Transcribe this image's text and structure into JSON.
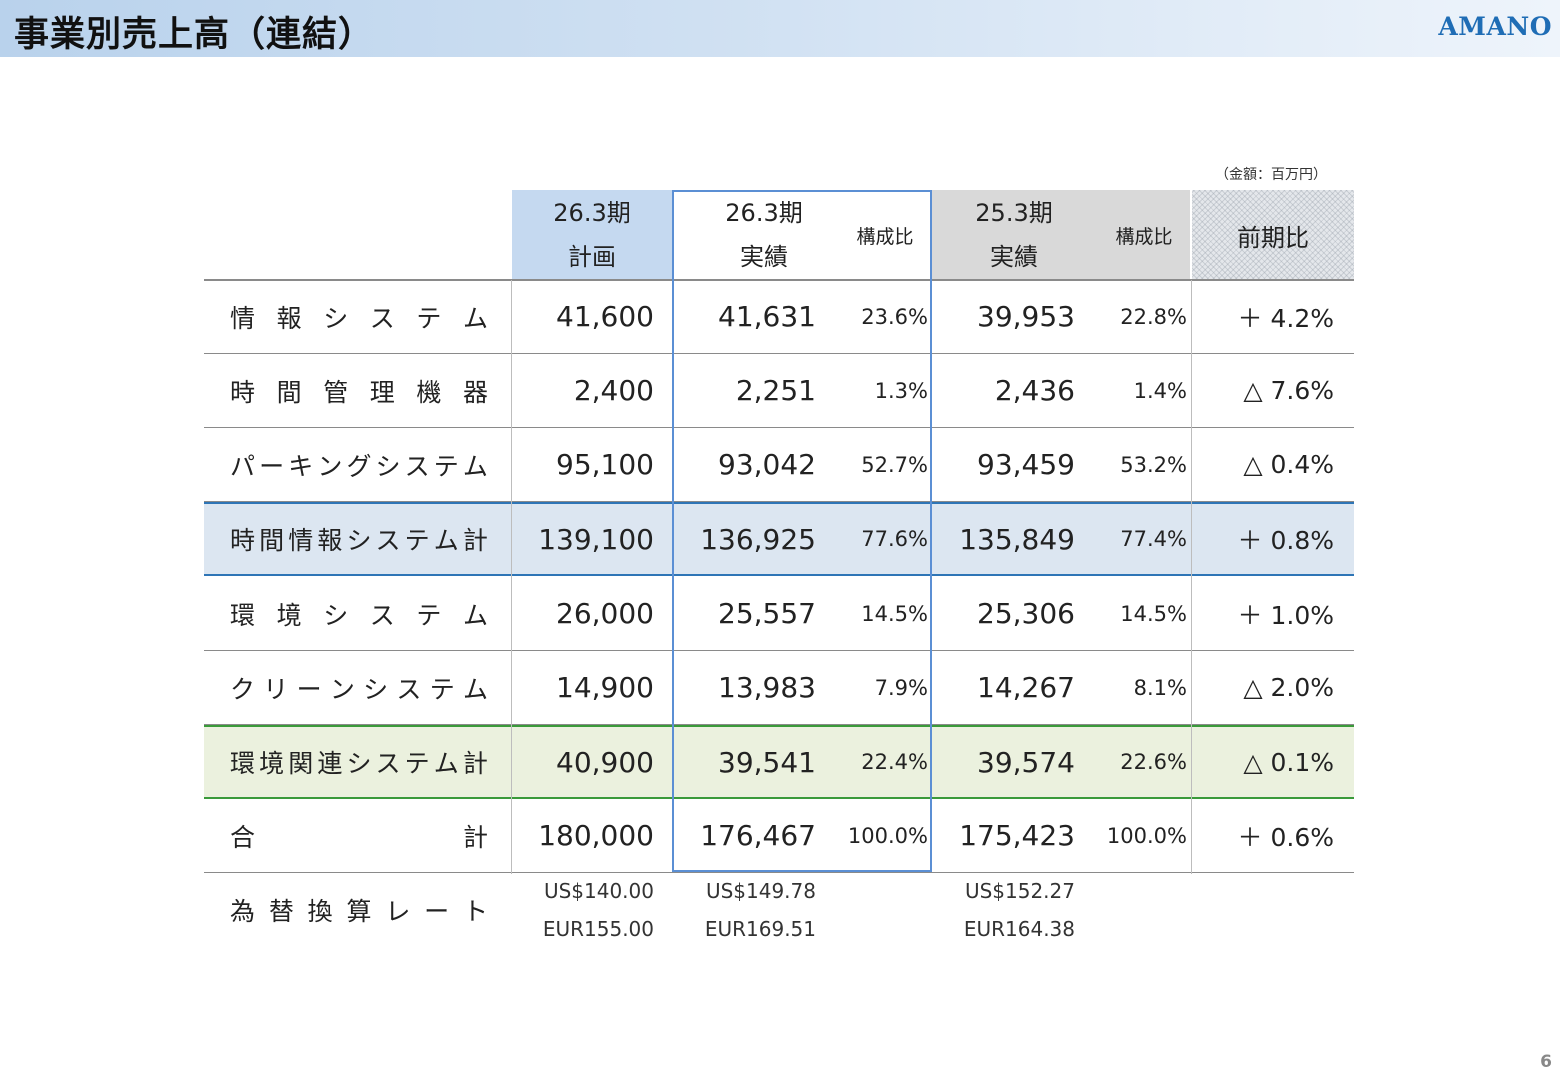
{
  "header": {
    "title": "事業別売上高（連結）",
    "logo": "AMANO"
  },
  "unit_note": "（金額：百万円）",
  "page_number": "6",
  "columns": {
    "plan": {
      "line1": "26.3期",
      "line2": "計画"
    },
    "actual": {
      "line1": "26.3期",
      "line2": "実績",
      "ratio": "構成比"
    },
    "prev": {
      "line1": "25.3期",
      "line2": "実績",
      "ratio": "構成比"
    },
    "yoy": "前期比"
  },
  "rows": [
    {
      "label_chars": [
        "情",
        "報",
        "シ",
        "ス",
        "テ",
        "ム"
      ],
      "plan": "41,600",
      "actual": "41,631",
      "actual_ratio": "23.6%",
      "prev": "39,953",
      "prev_ratio": "22.8%",
      "yoy": "＋ 4.2%"
    },
    {
      "label_chars": [
        "時",
        "間",
        "管",
        "理",
        "機",
        "器"
      ],
      "plan": "2,400",
      "actual": "2,251",
      "actual_ratio": "1.3%",
      "prev": "2,436",
      "prev_ratio": "1.4%",
      "yoy": "△ 7.6%"
    },
    {
      "label_chars": [
        "パ",
        "ー",
        "キ",
        "ン",
        "グ",
        "シ",
        "ス",
        "テ",
        "ム"
      ],
      "plan": "95,100",
      "actual": "93,042",
      "actual_ratio": "52.7%",
      "prev": "93,459",
      "prev_ratio": "53.2%",
      "yoy": "△ 0.4%"
    },
    {
      "label_chars": [
        "時",
        "間",
        "情",
        "報",
        "シ",
        "ス",
        "テ",
        "ム",
        "計"
      ],
      "plan": "139,100",
      "actual": "136,925",
      "actual_ratio": "77.6%",
      "prev": "135,849",
      "prev_ratio": "77.4%",
      "yoy": "＋ 0.8%"
    },
    {
      "label_chars": [
        "環",
        "境",
        "シ",
        "ス",
        "テ",
        "ム"
      ],
      "plan": "26,000",
      "actual": "25,557",
      "actual_ratio": "14.5%",
      "prev": "25,306",
      "prev_ratio": "14.5%",
      "yoy": "＋ 1.0%"
    },
    {
      "label_chars": [
        "ク",
        "リ",
        "ー",
        "ン",
        "シ",
        "ス",
        "テ",
        "ム"
      ],
      "plan": "14,900",
      "actual": "13,983",
      "actual_ratio": "7.9%",
      "prev": "14,267",
      "prev_ratio": "8.1%",
      "yoy": "△ 2.0%"
    },
    {
      "label_chars": [
        "環",
        "境",
        "関",
        "連",
        "シ",
        "ス",
        "テ",
        "ム",
        "計"
      ],
      "plan": "40,900",
      "actual": "39,541",
      "actual_ratio": "22.4%",
      "prev": "39,574",
      "prev_ratio": "22.6%",
      "yoy": "△ 0.1%"
    },
    {
      "label_chars": [
        "合",
        "計"
      ],
      "plan": "180,000",
      "actual": "176,467",
      "actual_ratio": "100.0%",
      "prev": "175,423",
      "prev_ratio": "100.0%",
      "yoy": "＋ 0.6%"
    }
  ],
  "fx": {
    "label_chars": [
      "為",
      "替",
      "換",
      "算",
      "レ",
      "ー",
      "ト"
    ],
    "plan_usd": "US$140.00",
    "plan_eur": "EUR155.00",
    "actual_usd": "US$149.78",
    "actual_eur": "EUR169.51",
    "prev_usd": "US$152.27",
    "prev_eur": "EUR164.38"
  }
}
